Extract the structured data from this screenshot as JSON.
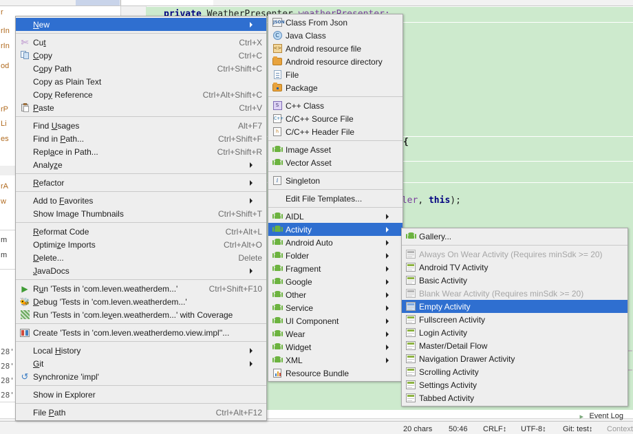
{
  "editor": {
    "code_line": "private WeatherPresenter weatherPresenter;",
    "code_tokens": {
      "kw": "private",
      "type": "WeatherPresenter",
      "field": "weatherPresenter;"
    },
    "brace_line": "{",
    "tail_line": "dler, this);"
  },
  "left_pane": {
    "fragments": [
      "r",
      "rIn",
      "rIn",
      "od",
      "rP",
      "Li",
      "es",
      "rA",
      "w",
      "m",
      "m",
      "28'",
      "28'",
      "28'",
      "28'"
    ]
  },
  "status_bar": {
    "chars": "20 chars",
    "caret": "50:46",
    "line_sep": "CRLF↕",
    "encoding": "UTF-8↕",
    "branch": "Git: test↕",
    "context": "Context:",
    "event_log": "Event Log"
  },
  "context_menu": {
    "name": "editor-context-menu",
    "items": [
      {
        "label": "New",
        "mnemonic": "N",
        "shortcut": "",
        "arrow": true,
        "icon": "",
        "selected": true
      },
      {
        "sep": true
      },
      {
        "label": "Cut",
        "mnemonic": "t",
        "shortcut": "Ctrl+X",
        "arrow": false,
        "icon": "scissors-icon"
      },
      {
        "label": "Copy",
        "mnemonic": "C",
        "shortcut": "Ctrl+C",
        "arrow": false,
        "icon": "copy-icon"
      },
      {
        "label": "Copy Path",
        "mnemonic": "o",
        "shortcut": "Ctrl+Shift+C",
        "arrow": false,
        "icon": ""
      },
      {
        "label": "Copy as Plain Text",
        "mnemonic": "",
        "shortcut": "",
        "arrow": false,
        "icon": ""
      },
      {
        "label": "Copy Reference",
        "mnemonic": "y",
        "shortcut": "Ctrl+Alt+Shift+C",
        "arrow": false,
        "icon": ""
      },
      {
        "label": "Paste",
        "mnemonic": "P",
        "shortcut": "Ctrl+V",
        "arrow": false,
        "icon": "paste-icon"
      },
      {
        "sep": true
      },
      {
        "label": "Find Usages",
        "mnemonic": "U",
        "shortcut": "Alt+F7",
        "arrow": false,
        "icon": ""
      },
      {
        "label": "Find in Path...",
        "mnemonic": "P",
        "shortcut": "Ctrl+Shift+F",
        "arrow": false,
        "icon": ""
      },
      {
        "label": "Replace in Path...",
        "mnemonic": "a",
        "shortcut": "Ctrl+Shift+R",
        "arrow": false,
        "icon": ""
      },
      {
        "label": "Analyze",
        "mnemonic": "z",
        "shortcut": "",
        "arrow": true,
        "icon": ""
      },
      {
        "sep": true
      },
      {
        "label": "Refactor",
        "mnemonic": "R",
        "shortcut": "",
        "arrow": true,
        "icon": ""
      },
      {
        "sep": true
      },
      {
        "label": "Add to Favorites",
        "mnemonic": "F",
        "shortcut": "",
        "arrow": true,
        "icon": ""
      },
      {
        "label": "Show Image Thumbnails",
        "mnemonic": "",
        "shortcut": "Ctrl+Shift+T",
        "arrow": false,
        "icon": ""
      },
      {
        "sep": true
      },
      {
        "label": "Reformat Code",
        "mnemonic": "R",
        "shortcut": "Ctrl+Alt+L",
        "arrow": false,
        "icon": ""
      },
      {
        "label": "Optimize Imports",
        "mnemonic": "z",
        "shortcut": "Ctrl+Alt+O",
        "arrow": false,
        "icon": ""
      },
      {
        "label": "Delete...",
        "mnemonic": "D",
        "shortcut": "Delete",
        "arrow": false,
        "icon": ""
      },
      {
        "label": "JavaDocs",
        "mnemonic": "J",
        "shortcut": "",
        "arrow": true,
        "icon": ""
      },
      {
        "sep": true
      },
      {
        "label": "Run 'Tests in 'com.leven.weatherdem...'",
        "mnemonic": "u",
        "shortcut": "Ctrl+Shift+F10",
        "arrow": false,
        "icon": "run-icon"
      },
      {
        "label": "Debug 'Tests in 'com.leven.weatherdem...'",
        "mnemonic": "D",
        "shortcut": "",
        "arrow": false,
        "icon": "debug-icon"
      },
      {
        "label": "Run 'Tests in 'com.leven.weatherdem...' with Coverage",
        "mnemonic": "v",
        "shortcut": "",
        "arrow": false,
        "icon": "coverage-icon"
      },
      {
        "sep": true
      },
      {
        "label": "Create 'Tests in 'com.leven.weatherdemo.view.impl''...",
        "mnemonic": "",
        "shortcut": "",
        "arrow": false,
        "icon": "create-test-icon"
      },
      {
        "sep": true
      },
      {
        "label": "Local History",
        "mnemonic": "H",
        "shortcut": "",
        "arrow": true,
        "icon": ""
      },
      {
        "label": "Git",
        "mnemonic": "G",
        "shortcut": "",
        "arrow": true,
        "icon": ""
      },
      {
        "label": "Synchronize 'impl'",
        "mnemonic": "",
        "shortcut": "",
        "arrow": false,
        "icon": "sync-icon"
      },
      {
        "sep": true
      },
      {
        "label": "Show in Explorer",
        "mnemonic": "",
        "shortcut": "",
        "arrow": false,
        "icon": ""
      },
      {
        "sep": true
      },
      {
        "label": "File Path",
        "mnemonic": "P",
        "shortcut": "Ctrl+Alt+F12",
        "arrow": false,
        "icon": ""
      }
    ]
  },
  "new_submenu": {
    "name": "new-submenu",
    "items": [
      {
        "label": "Class From Json",
        "icon": "json-icon",
        "arrow": false
      },
      {
        "label": "Java Class",
        "icon": "java-class-icon",
        "arrow": false
      },
      {
        "label": "Android resource file",
        "icon": "resource-file-icon",
        "arrow": false
      },
      {
        "label": "Android resource directory",
        "icon": "folder-icon",
        "arrow": false
      },
      {
        "label": "File",
        "icon": "file-icon",
        "arrow": false
      },
      {
        "label": "Package",
        "icon": "package-icon",
        "arrow": false
      },
      {
        "sep": true
      },
      {
        "label": "C++ Class",
        "icon": "cpp-class-icon",
        "arrow": false
      },
      {
        "label": "C/C++ Source File",
        "icon": "cpp-source-icon",
        "arrow": false
      },
      {
        "label": "C/C++ Header File",
        "icon": "cpp-header-icon",
        "arrow": false
      },
      {
        "sep": true
      },
      {
        "label": "Image Asset",
        "icon": "android-icon",
        "arrow": false
      },
      {
        "label": "Vector Asset",
        "icon": "android-icon",
        "arrow": false
      },
      {
        "sep": true
      },
      {
        "label": "Singleton",
        "icon": "singleton-icon",
        "arrow": false
      },
      {
        "sep": true
      },
      {
        "label": "Edit File Templates...",
        "icon": "",
        "arrow": false
      },
      {
        "sep": true
      },
      {
        "label": "AIDL",
        "icon": "android-icon",
        "arrow": true
      },
      {
        "label": "Activity",
        "icon": "android-icon",
        "arrow": true,
        "selected": true
      },
      {
        "label": "Android Auto",
        "icon": "android-icon",
        "arrow": true
      },
      {
        "label": "Folder",
        "icon": "android-icon",
        "arrow": true
      },
      {
        "label": "Fragment",
        "icon": "android-icon",
        "arrow": true
      },
      {
        "label": "Google",
        "icon": "android-icon",
        "arrow": true
      },
      {
        "label": "Other",
        "icon": "android-icon",
        "arrow": true
      },
      {
        "label": "Service",
        "icon": "android-icon",
        "arrow": true
      },
      {
        "label": "UI Component",
        "icon": "android-icon",
        "arrow": true
      },
      {
        "label": "Wear",
        "icon": "android-icon",
        "arrow": true
      },
      {
        "label": "Widget",
        "icon": "android-icon",
        "arrow": true
      },
      {
        "label": "XML",
        "icon": "android-icon",
        "arrow": true
      },
      {
        "label": "Resource Bundle",
        "icon": "resource-bundle-icon",
        "arrow": false
      }
    ]
  },
  "activity_submenu": {
    "name": "activity-submenu",
    "items": [
      {
        "label": "Gallery...",
        "icon": "android-icon"
      },
      {
        "sep": true
      },
      {
        "label": "Always On Wear Activity (Requires minSdk >= 20)",
        "icon": "template-gray-icon",
        "disabled": true
      },
      {
        "label": "Android TV Activity",
        "icon": "template-icon"
      },
      {
        "label": "Basic Activity",
        "icon": "template-icon"
      },
      {
        "label": "Blank Wear Activity (Requires minSdk >= 20)",
        "icon": "template-gray-icon",
        "disabled": true
      },
      {
        "label": "Empty Activity",
        "icon": "template-blue-icon",
        "selected": true
      },
      {
        "label": "Fullscreen Activity",
        "icon": "template-icon"
      },
      {
        "label": "Login Activity",
        "icon": "template-icon"
      },
      {
        "label": "Master/Detail Flow",
        "icon": "template-icon"
      },
      {
        "label": "Navigation Drawer Activity",
        "icon": "template-icon"
      },
      {
        "label": "Scrolling Activity",
        "icon": "template-icon"
      },
      {
        "label": "Settings Activity",
        "icon": "template-icon"
      },
      {
        "label": "Tabbed Activity",
        "icon": "template-icon"
      }
    ]
  },
  "colors": {
    "menu_bg": "#eeeeee",
    "selection": "#2f6fd0",
    "code_band": "#cdeacd",
    "android_green": "#6cb33f"
  }
}
